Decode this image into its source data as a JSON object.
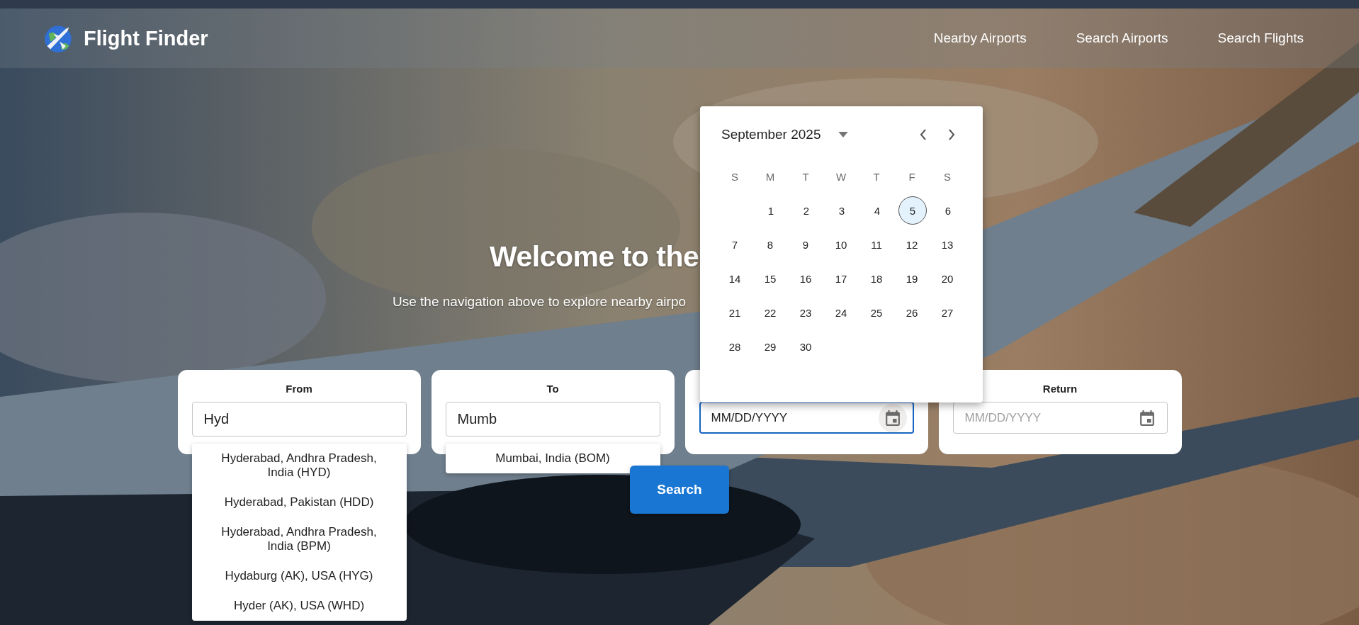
{
  "header": {
    "brand": "Flight Finder",
    "nav": [
      {
        "label": "Nearby Airports"
      },
      {
        "label": "Search Airports"
      },
      {
        "label": "Search Flights"
      }
    ]
  },
  "hero": {
    "title": "Welcome to the",
    "subtitle": "Use the navigation above to explore nearby airpo"
  },
  "fields": [
    {
      "kind": "text",
      "label": "From",
      "value": "Hyd",
      "suggestions": [
        "Hyderabad, Andhra Pradesh, India (HYD)",
        "Hyderabad, Pakistan (HDD)",
        "Hyderabad, Andhra Pradesh, India (BPM)",
        "Hydaburg (AK), USA (HYG)",
        "Hyder (AK), USA (WHD)"
      ]
    },
    {
      "kind": "text",
      "label": "To",
      "value": "Mumb",
      "suggestions": [
        "Mumbai, India (BOM)"
      ]
    },
    {
      "kind": "date",
      "value": "MM/DD/YYYY",
      "focused": true
    },
    {
      "kind": "date",
      "label": "Return",
      "placeholder": "MM/DD/YYYY",
      "focused": false
    }
  ],
  "search_button": "Search",
  "calendar": {
    "month": "September 2025",
    "weekdays": [
      "S",
      "M",
      "T",
      "W",
      "T",
      "F",
      "S"
    ],
    "weeks": [
      [
        {
          "label": "1",
          "selected": false
        },
        {
          "label": "2",
          "selected": false
        },
        {
          "label": "3",
          "selected": false
        },
        {
          "label": "4",
          "selected": false
        },
        {
          "label": "5",
          "selected": true
        },
        {
          "label": "6",
          "selected": false
        }
      ],
      [
        {
          "label": "7",
          "selected": false
        },
        {
          "label": "8",
          "selected": false
        },
        {
          "label": "9",
          "selected": false
        },
        {
          "label": "10",
          "selected": false
        },
        {
          "label": "11",
          "selected": false
        },
        {
          "label": "12",
          "selected": false
        },
        {
          "label": "13",
          "selected": false
        }
      ],
      [
        {
          "label": "14",
          "selected": false
        },
        {
          "label": "15",
          "selected": false
        },
        {
          "label": "16",
          "selected": false
        },
        {
          "label": "17",
          "selected": false
        },
        {
          "label": "18",
          "selected": false
        },
        {
          "label": "19",
          "selected": false
        },
        {
          "label": "20",
          "selected": false
        }
      ],
      [
        {
          "label": "21",
          "selected": false
        },
        {
          "label": "22",
          "selected": false
        },
        {
          "label": "23",
          "selected": false
        },
        {
          "label": "24",
          "selected": false
        },
        {
          "label": "25",
          "selected": false
        },
        {
          "label": "26",
          "selected": false
        },
        {
          "label": "27",
          "selected": false
        }
      ],
      [
        {
          "label": "28",
          "selected": false
        },
        {
          "label": "29",
          "selected": false
        },
        {
          "label": "30",
          "selected": false
        }
      ]
    ]
  }
}
